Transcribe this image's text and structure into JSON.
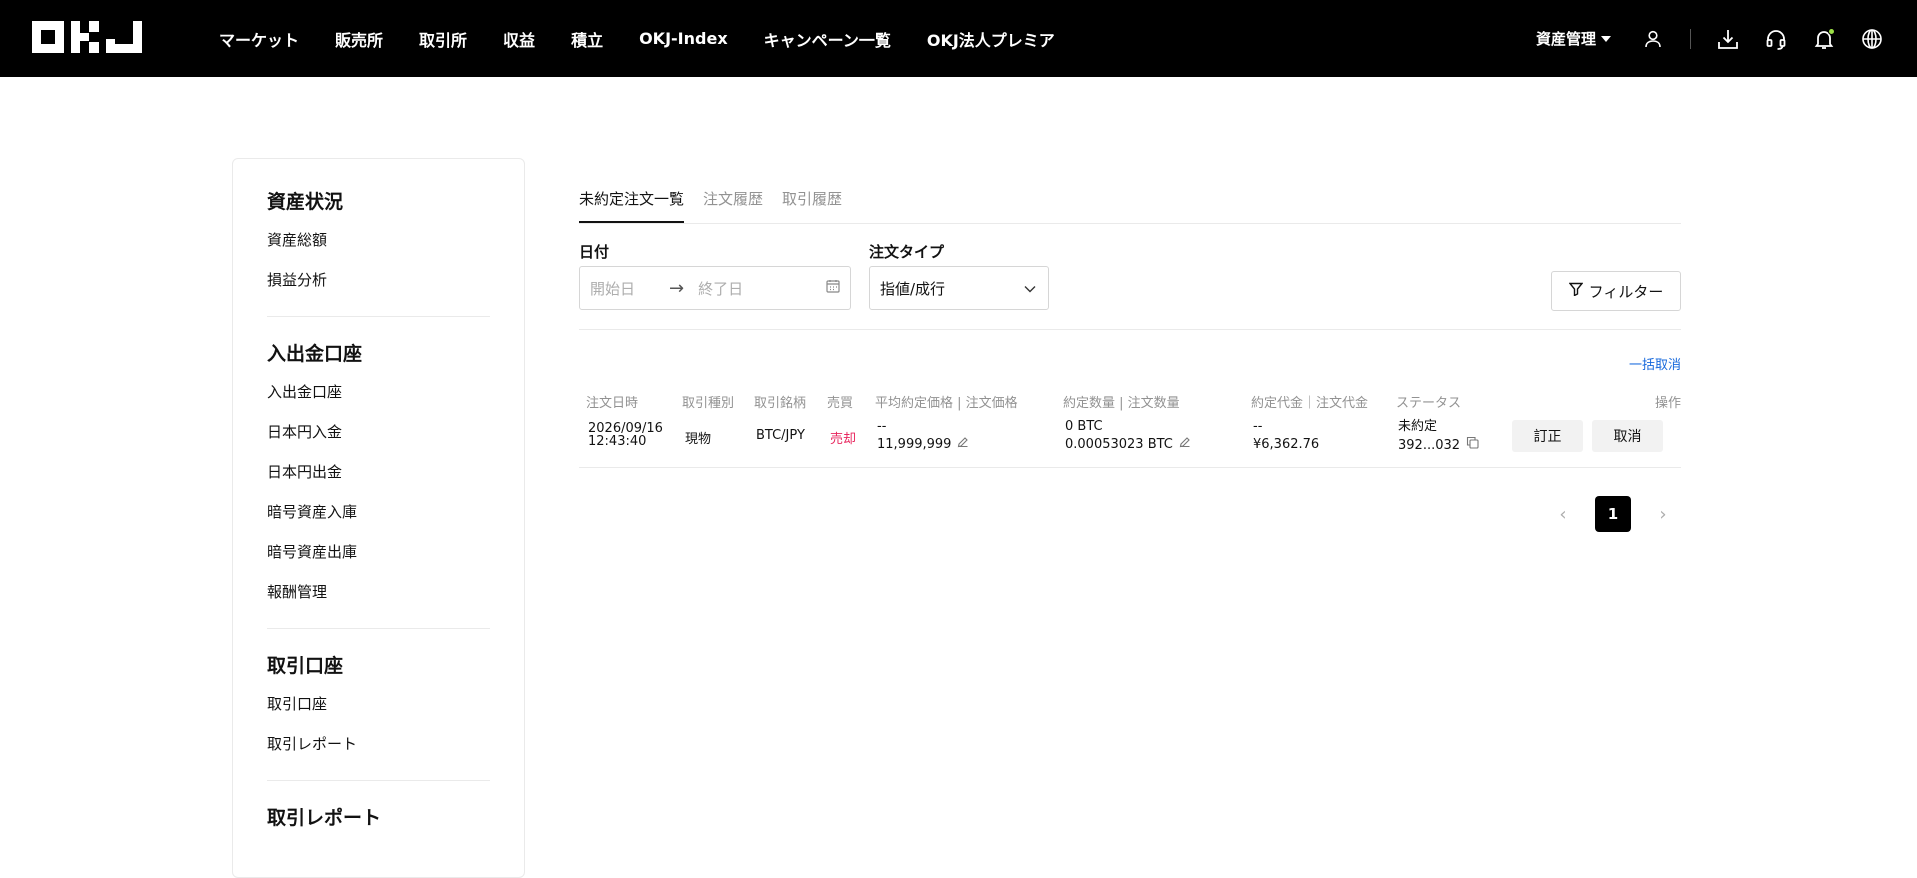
{
  "header": {
    "logo": "OKJ",
    "nav": [
      "マーケット",
      "販売所",
      "取引所",
      "収益",
      "積立",
      "OKJ-Index",
      "キャンペーン一覧",
      "OKJ法人プレミア"
    ],
    "asset_menu": "資産管理",
    "icons": [
      "user-icon",
      "download-icon",
      "headset-icon",
      "bell-icon",
      "globe-icon"
    ],
    "notification_dot_color": "#9bdf46"
  },
  "sidebar": {
    "groups": [
      {
        "title": "資産状況",
        "items": [
          "資産総額",
          "損益分析"
        ]
      },
      {
        "title": "入出金口座",
        "items": [
          "入出金口座",
          "日本円入金",
          "日本円出金",
          "暗号資産入庫",
          "暗号資産出庫",
          "報酬管理"
        ]
      },
      {
        "title": "取引口座",
        "items": [
          "取引口座",
          "取引レポート"
        ]
      },
      {
        "title": "取引レポート",
        "items": []
      }
    ]
  },
  "tabs": {
    "items": [
      "未約定注文一覧",
      "注文履歴",
      "取引履歴"
    ],
    "active": "未約定注文一覧"
  },
  "filters": {
    "date_label": "日付",
    "start_placeholder": "開始日",
    "end_placeholder": "終了日",
    "type_label": "注文タイプ",
    "type_value": "指値/成行",
    "filter_button": "フィルター"
  },
  "table": {
    "bulk_cancel": "一括取消",
    "columns": [
      "注文日時",
      "取引種別",
      "取引銘柄",
      "売買",
      "平均約定価格 | 注文価格",
      "約定数量 | 注文数量",
      "約定代金｜注文代金",
      "ステータス",
      "操作"
    ],
    "rows": [
      {
        "date": "2026/09/16",
        "time": "12:43:40",
        "kind": "現物",
        "pair": "BTC/JPY",
        "side": "売却",
        "avg_price": "--",
        "order_price": "11,999,999",
        "filled_qty": "0 BTC",
        "order_qty": "0.00053023 BTC",
        "filled_amount": "--",
        "order_amount": "¥6,362.76",
        "status": "未約定",
        "order_id": "392...032",
        "edit_btn": "訂正",
        "cancel_btn": "取消"
      }
    ]
  },
  "pagination": {
    "current": "1"
  },
  "colors": {
    "sell": "#e8265e",
    "link": "#1668dc",
    "header_bg": "#000000"
  }
}
